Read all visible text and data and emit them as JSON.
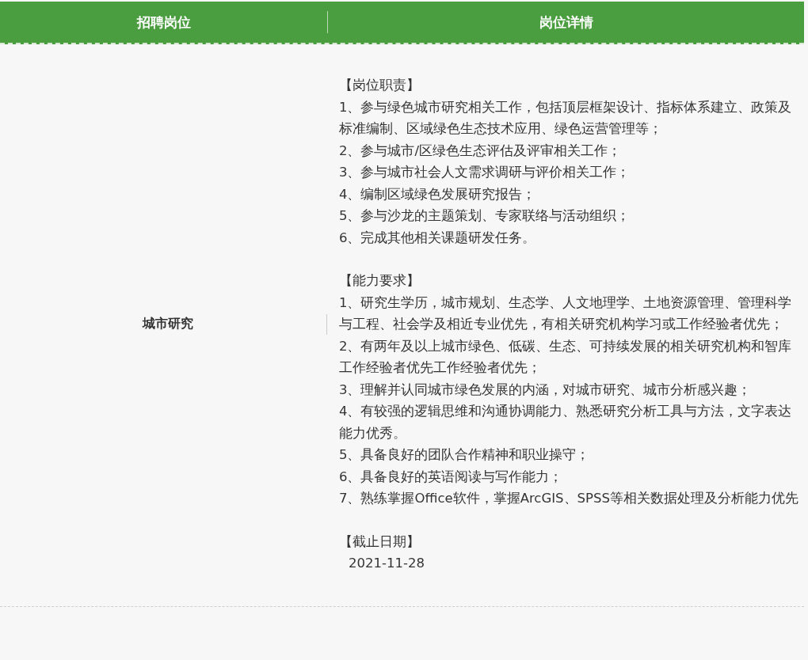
{
  "table": {
    "columns": [
      "招聘岗位",
      "岗位详情"
    ],
    "rows": [
      {
        "position": "城市研究",
        "sections": [
          {
            "heading": "【岗位职责】",
            "items": [
              "1、参与绿色城市研究相关工作，包括顶层框架设计、指标体系建立、政策及标准编制、区域绿色生态技术应用、绿色运营管理等；",
              "2、参与城市/区绿色生态评估及评审相关工作；",
              "3、参与城市社会人文需求调研与评价相关工作；",
              "4、编制区域绿色发展研究报告；",
              "5、参与沙龙的主题策划、专家联络与活动组织；",
              "6、完成其他相关课题研发任务。"
            ]
          },
          {
            "heading": "【能力要求】",
            "items": [
              "1、研究生学历，城市规划、生态学、人文地理学、土地资源管理、管理科学与工程、社会学及相近专业优先，有相关研究机构学习或工作经验者优先；",
              "2、有两年及以上城市绿色、低碳、生态、可持续发展的相关研究机构和智库工作经验者优先工作经验者优先；",
              "3、理解并认同城市绿色发展的内涵，对城市研究、城市分析感兴趣；",
              "4、有较强的逻辑思维和沟通协调能力、熟悉研究分析工具与方法，文字表达能力优秀。",
              "5、具备良好的团队合作精神和职业操守；",
              "6、具备良好的英语阅读与写作能力；",
              "7、熟练掌握Office软件，掌握ArcGIS、SPSS等相关数据处理及分析能力优先"
            ]
          },
          {
            "heading": "【截止日期】",
            "items": [
              "2021-11-28"
            ]
          }
        ]
      }
    ]
  }
}
